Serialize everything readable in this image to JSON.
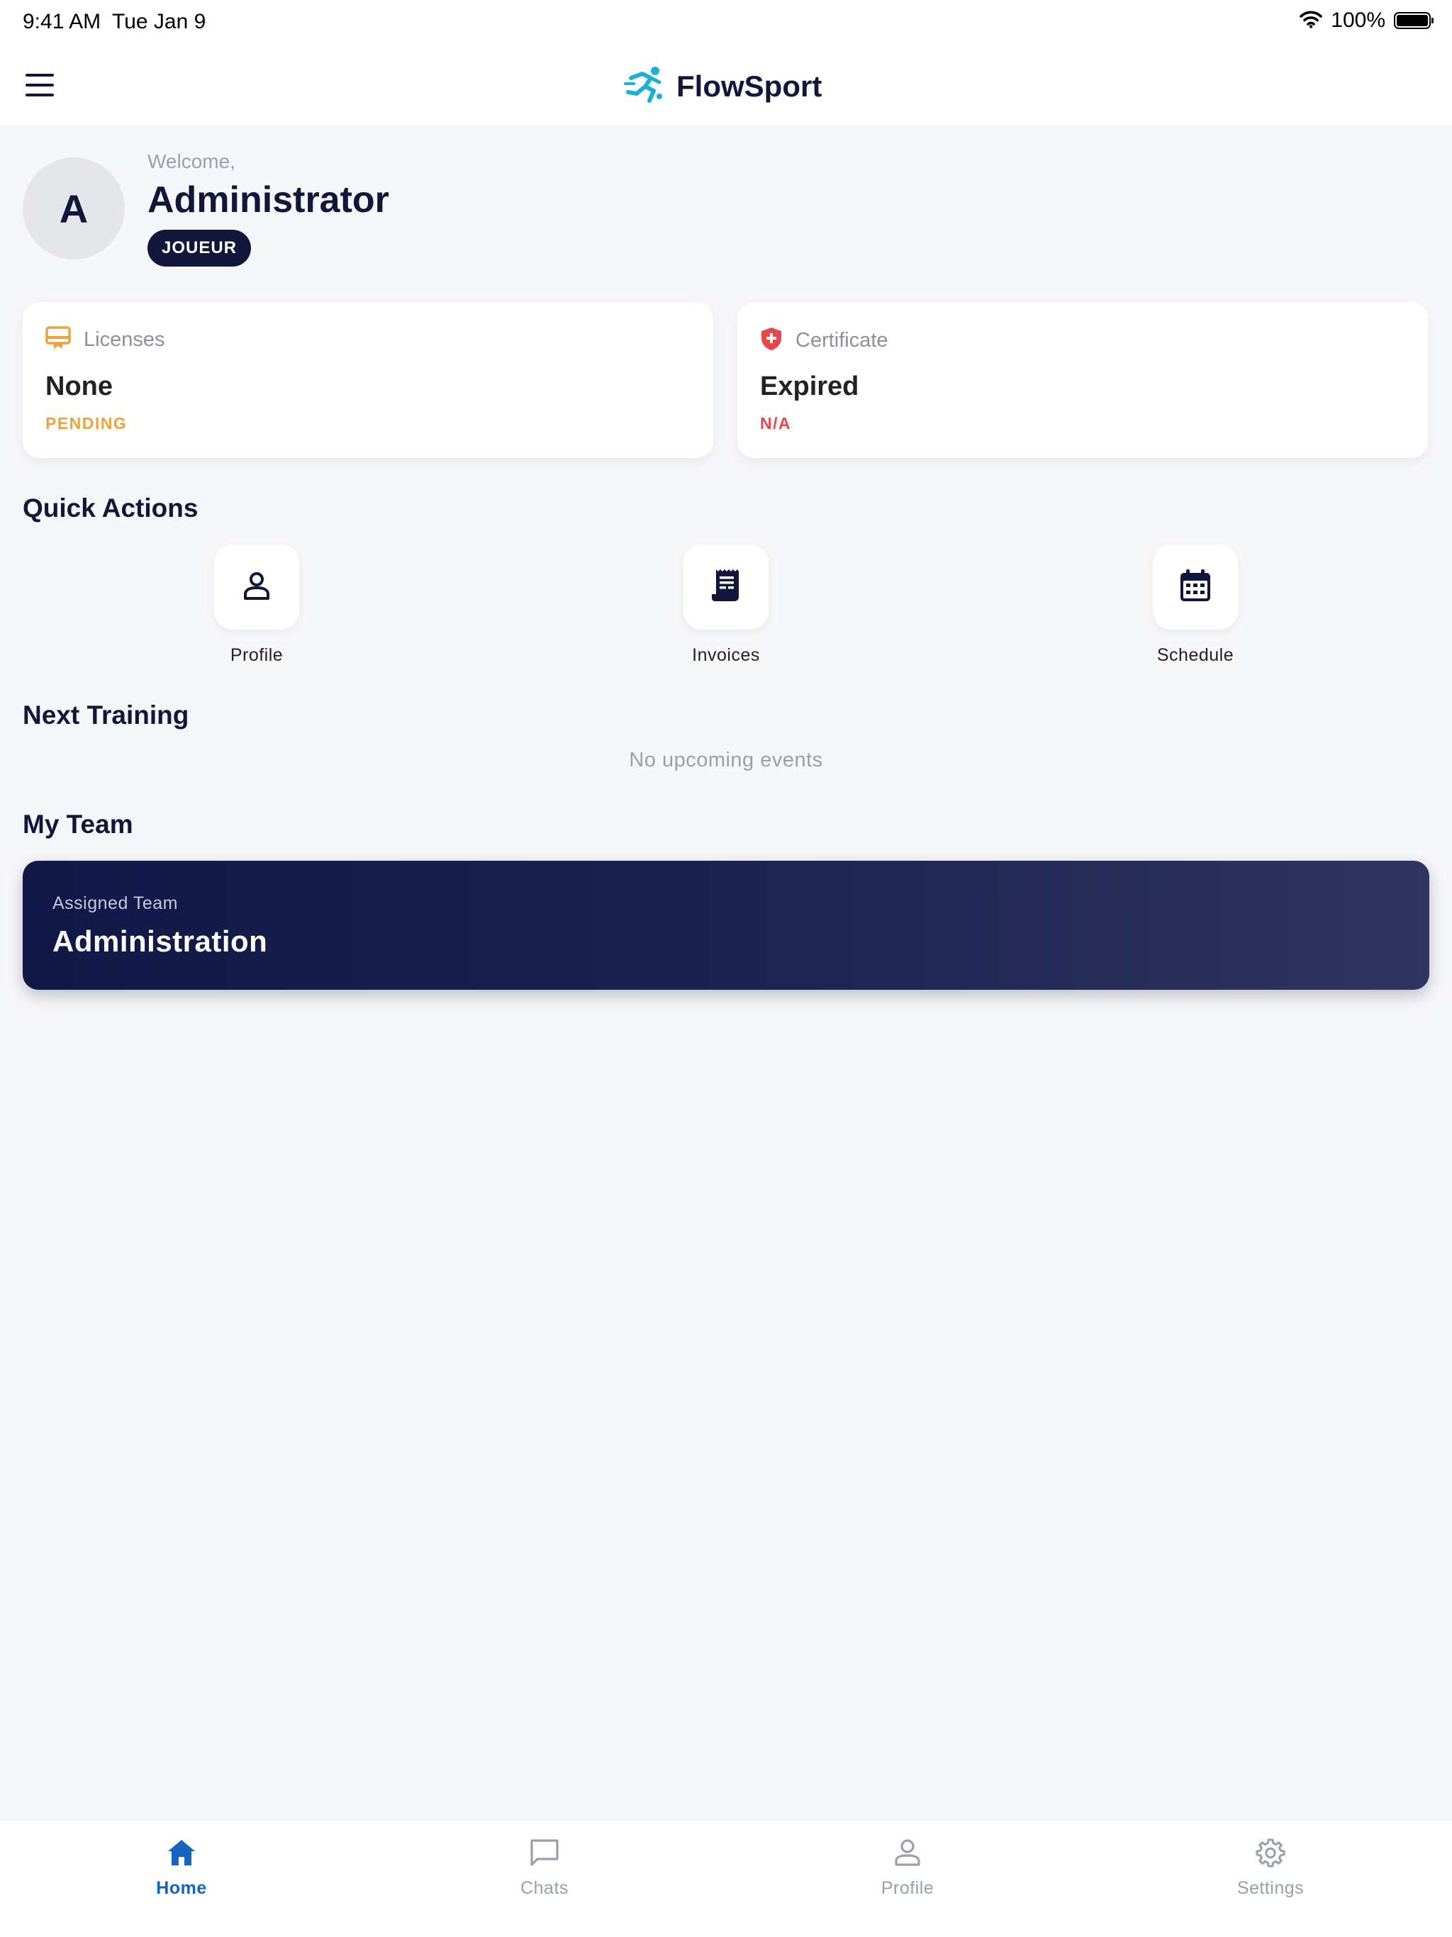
{
  "status_bar": {
    "time": "9:41 AM",
    "date": "Tue Jan 9",
    "battery": "100%"
  },
  "header": {
    "app_title": "FlowSport"
  },
  "welcome": {
    "label": "Welcome,",
    "name": "Administrator",
    "initial": "A",
    "role": "JOUEUR"
  },
  "cards": {
    "licenses": {
      "label": "Licenses",
      "value": "None",
      "status": "PENDING"
    },
    "certificate": {
      "label": "Certificate",
      "value": "Expired",
      "status": "N/A"
    }
  },
  "quick_actions": {
    "title": "Quick Actions",
    "items": [
      {
        "label": "Profile",
        "icon": "person-icon"
      },
      {
        "label": "Invoices",
        "icon": "receipt-icon"
      },
      {
        "label": "Schedule",
        "icon": "calendar-icon"
      }
    ]
  },
  "next_training": {
    "title": "Next Training",
    "empty": "No upcoming events"
  },
  "my_team": {
    "title": "My Team",
    "label": "Assigned Team",
    "name": "Administration"
  },
  "tabs": [
    {
      "label": "Home",
      "icon": "home-icon",
      "active": true
    },
    {
      "label": "Chats",
      "icon": "chat-icon",
      "active": false
    },
    {
      "label": "Profile",
      "icon": "person-icon",
      "active": false
    },
    {
      "label": "Settings",
      "icon": "gear-icon",
      "active": false
    }
  ],
  "colors": {
    "primary": "#12163a",
    "accent": "#1565c0",
    "brand_icon": "#1ab0d8",
    "pending": "#f0a13a",
    "expired": "#e8474a",
    "background": "#f6f7f9"
  }
}
